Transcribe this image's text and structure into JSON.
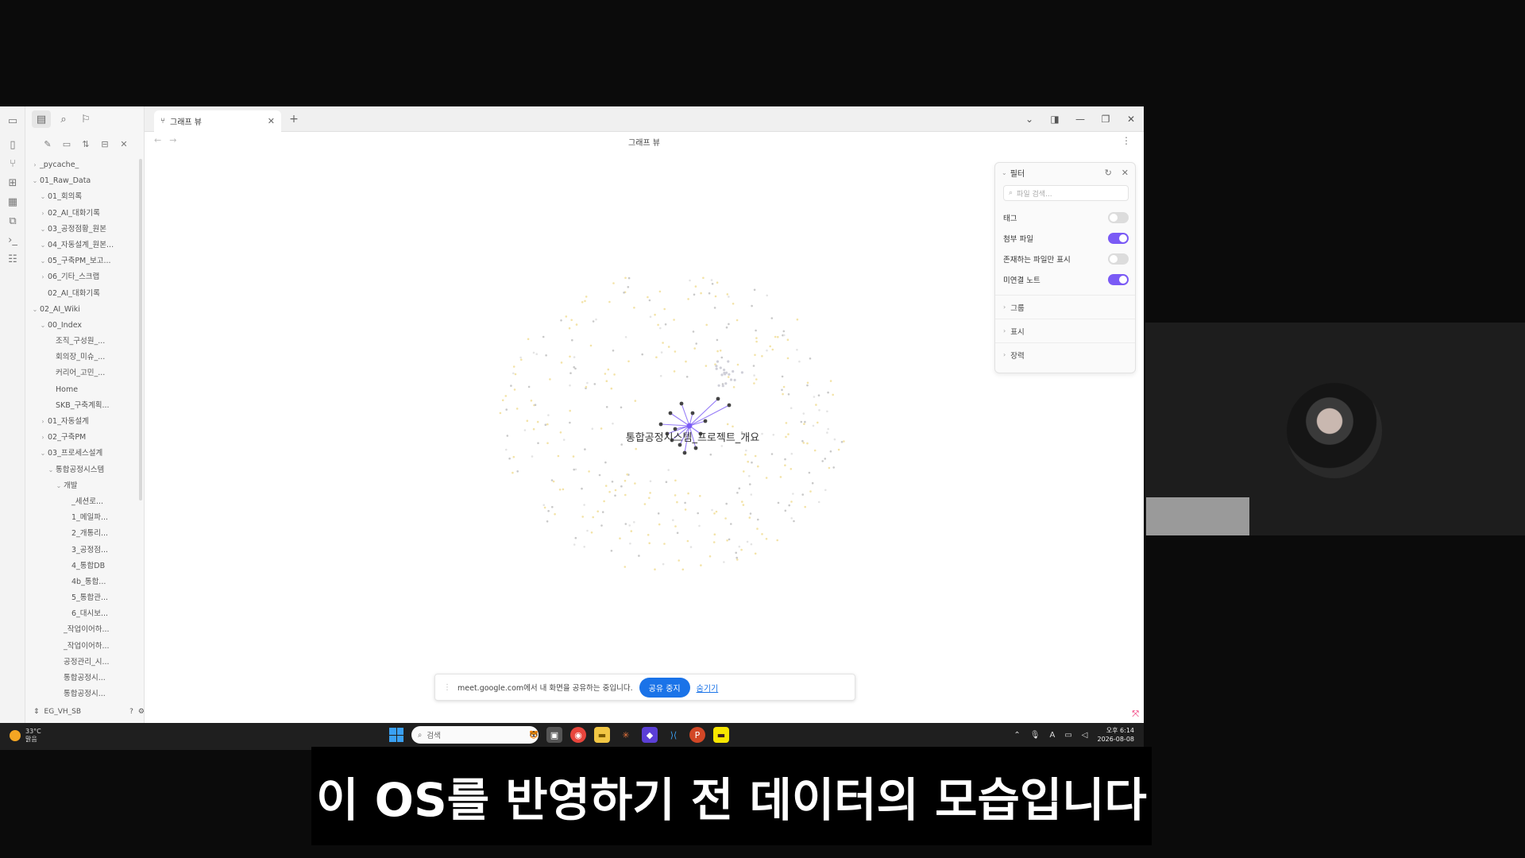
{
  "tab": {
    "label": "그래프 뷰",
    "icon": "graph-icon"
  },
  "view": {
    "title": "그래프 뷰"
  },
  "tree": [
    {
      "label": "_pycache_",
      "depth": 0,
      "chev": "right"
    },
    {
      "label": "01_Raw_Data",
      "depth": 0,
      "chev": "down"
    },
    {
      "label": "01_회의록",
      "depth": 1,
      "chev": "down"
    },
    {
      "label": "02_AI_대화기록",
      "depth": 1,
      "chev": "right"
    },
    {
      "label": "03_공정점황_원본",
      "depth": 1,
      "chev": "down"
    },
    {
      "label": "04_자동설계_원본...",
      "depth": 1,
      "chev": "down"
    },
    {
      "label": "05_구축PM_보고...",
      "depth": 1,
      "chev": "down"
    },
    {
      "label": "06_기타_스크랩",
      "depth": 1,
      "chev": "right"
    },
    {
      "label": "02_AI_대화기록",
      "depth": 1,
      "chev": "none"
    },
    {
      "label": "02_AI_Wiki",
      "depth": 0,
      "chev": "down"
    },
    {
      "label": "00_Index",
      "depth": 1,
      "chev": "down"
    },
    {
      "label": "조직_구성원_...",
      "depth": 2,
      "chev": "none"
    },
    {
      "label": "회의장_미슈_...",
      "depth": 2,
      "chev": "none"
    },
    {
      "label": "커리어_고민_...",
      "depth": 2,
      "chev": "none"
    },
    {
      "label": "Home",
      "depth": 2,
      "chev": "none"
    },
    {
      "label": "SKB_구축계획...",
      "depth": 2,
      "chev": "none"
    },
    {
      "label": "01_자동설계",
      "depth": 1,
      "chev": "right"
    },
    {
      "label": "02_구축PM",
      "depth": 1,
      "chev": "right"
    },
    {
      "label": "03_프로세스설계",
      "depth": 1,
      "chev": "down"
    },
    {
      "label": "통합공정시스템",
      "depth": 2,
      "chev": "down"
    },
    {
      "label": "개발",
      "depth": 3,
      "chev": "down"
    },
    {
      "label": "_세션로...",
      "depth": 4,
      "chev": "none"
    },
    {
      "label": "1_메일파...",
      "depth": 4,
      "chev": "none"
    },
    {
      "label": "2_개통리...",
      "depth": 4,
      "chev": "none"
    },
    {
      "label": "3_공정점...",
      "depth": 4,
      "chev": "none"
    },
    {
      "label": "4_통합DB",
      "depth": 4,
      "chev": "none"
    },
    {
      "label": "4b_통합...",
      "depth": 4,
      "chev": "none"
    },
    {
      "label": "5_통합관...",
      "depth": 4,
      "chev": "none"
    },
    {
      "label": "6_대시보...",
      "depth": 4,
      "chev": "none"
    },
    {
      "label": "_작업이어하...",
      "depth": 3,
      "chev": "none"
    },
    {
      "label": "_작업이어하...",
      "depth": 3,
      "chev": "none"
    },
    {
      "label": "공정관리_시...",
      "depth": 3,
      "chev": "none"
    },
    {
      "label": "통합공정시...",
      "depth": 3,
      "chev": "none"
    },
    {
      "label": "통합공정시...",
      "depth": 3,
      "chev": "none"
    }
  ],
  "vault": {
    "name": "EG_VH_SB"
  },
  "graph": {
    "focus_label": "통합공정시스템_프로젝트_개요",
    "accent": "#7a5af5"
  },
  "filter": {
    "title": "필터",
    "search_placeholder": "파일 검색...",
    "toggles": [
      {
        "label": "태그",
        "on": false
      },
      {
        "label": "첨부 파일",
        "on": true
      },
      {
        "label": "존재하는 파일만 표시",
        "on": false
      },
      {
        "label": "미연결 노트",
        "on": true
      }
    ],
    "sections": [
      "그룹",
      "표시",
      "장력"
    ]
  },
  "share": {
    "message": "meet.google.com에서 내 화면을 공유하는 중입니다.",
    "stop": "공유 중지",
    "hide": "숨기기"
  },
  "taskbar": {
    "temp": "33°C",
    "weather": "맑음",
    "search": "검색",
    "time": "오후 6:14",
    "date": "2026-08-08"
  },
  "subtitle": "이 OS를 반영하기 전 데이터의 모습입니다"
}
